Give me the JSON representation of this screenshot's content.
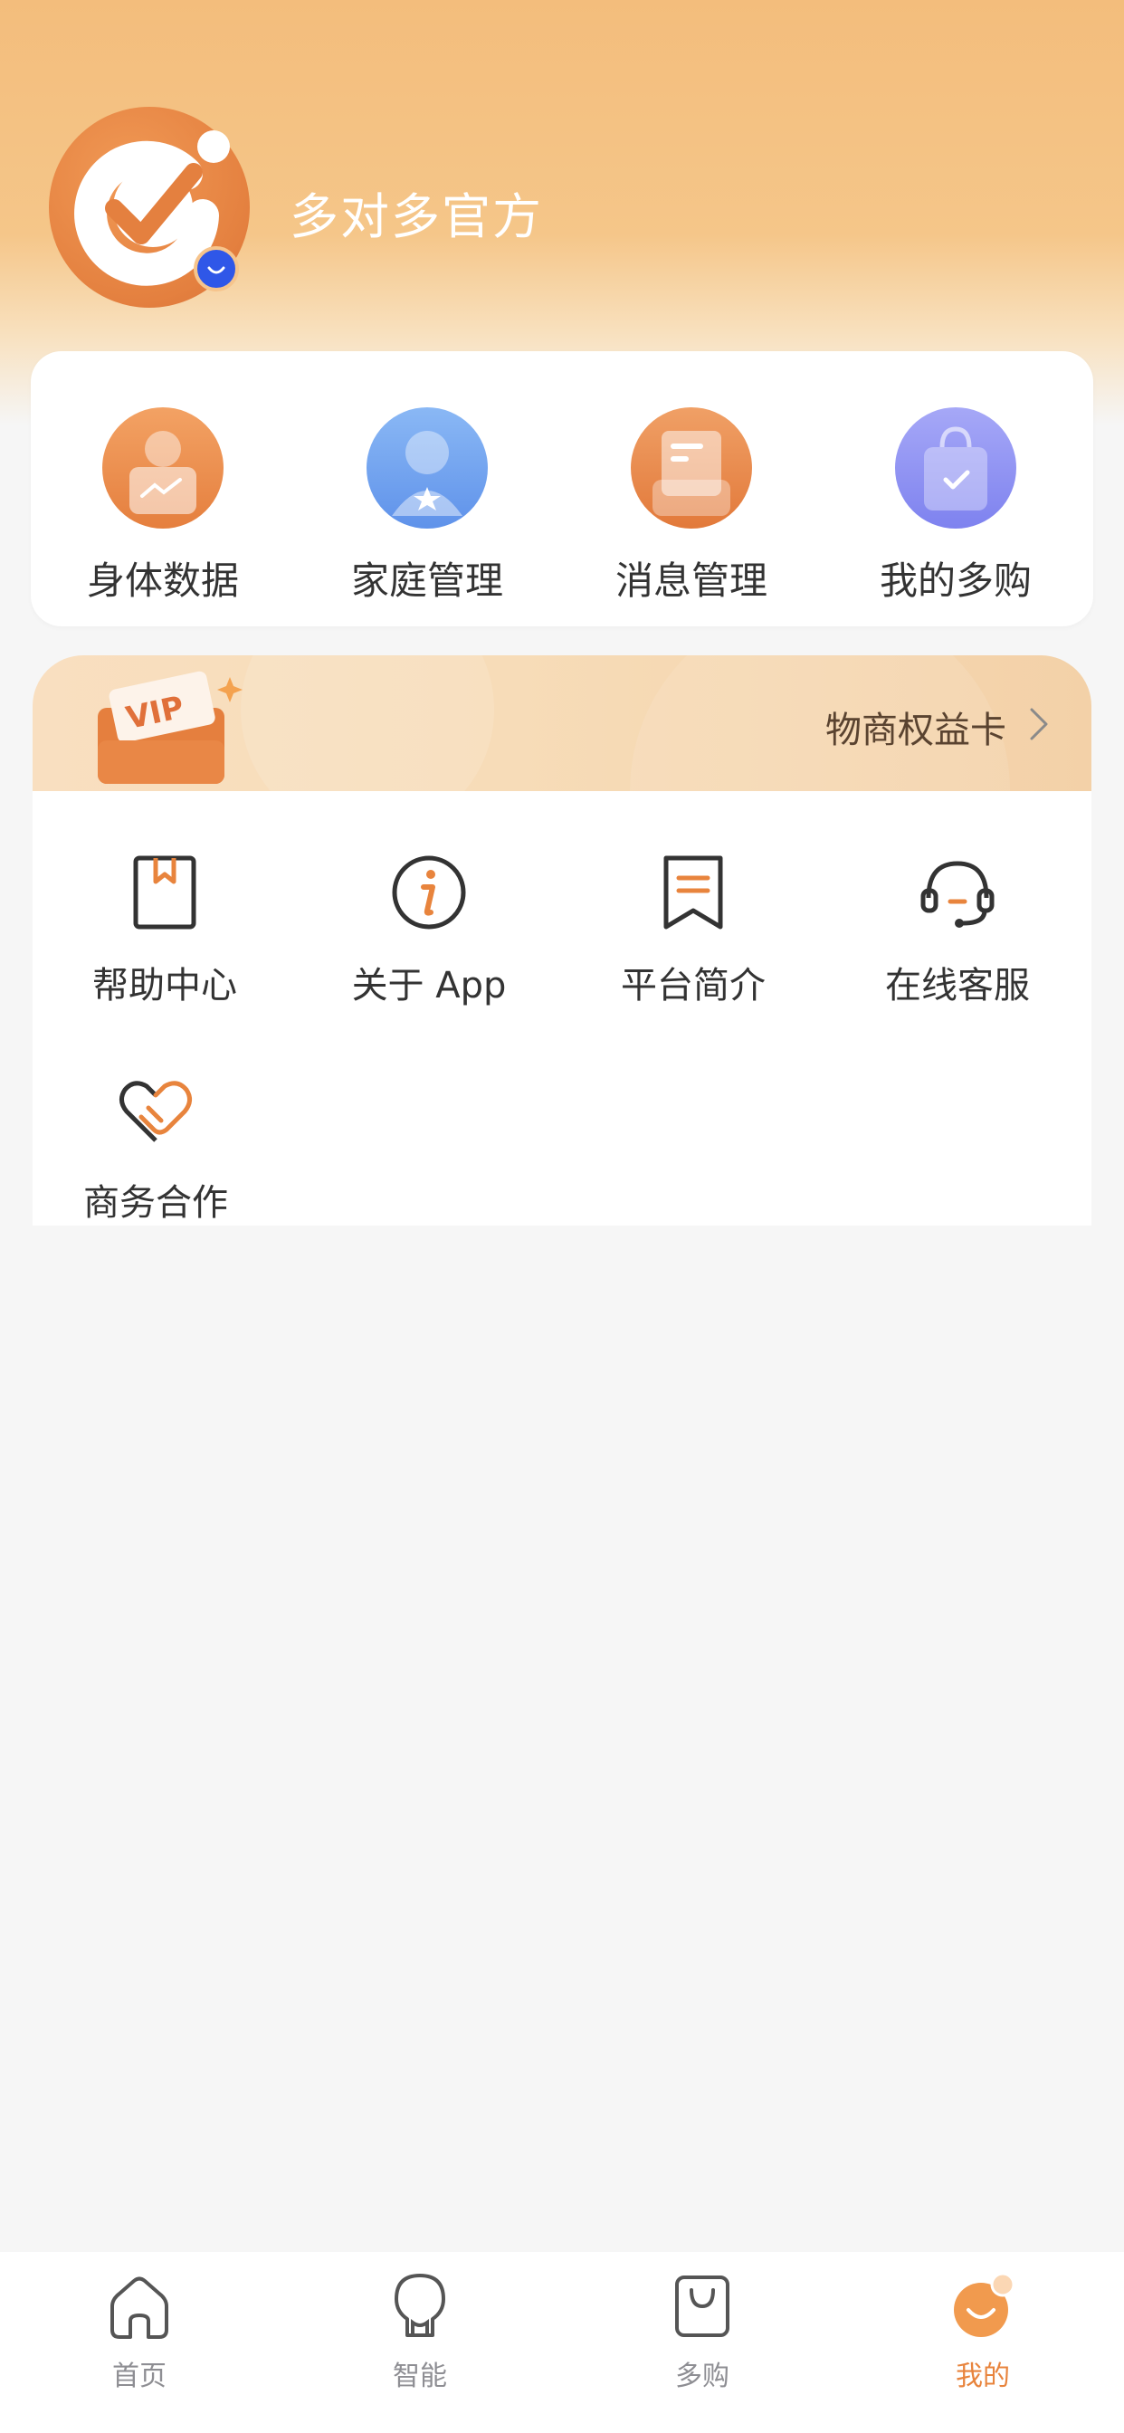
{
  "profile": {
    "username": "多对多官方"
  },
  "quick_actions": [
    {
      "label": "身体数据",
      "icon": "body-data-icon",
      "color": "#ec8d4b"
    },
    {
      "label": "家庭管理",
      "icon": "family-management-icon",
      "color": "#6fa2ee"
    },
    {
      "label": "消息管理",
      "icon": "message-management-icon",
      "color": "#ea8a4a"
    },
    {
      "label": "我的多购",
      "icon": "my-shopping-icon",
      "color": "#8c8ef2"
    }
  ],
  "vip_banner": {
    "badge": "VIP",
    "title": "物商权益卡"
  },
  "services": [
    {
      "label": "帮助中心",
      "icon": "bookmark-book-icon"
    },
    {
      "label": "关于 App",
      "icon": "info-icon"
    },
    {
      "label": "平台简介",
      "icon": "ribbon-doc-icon"
    },
    {
      "label": "在线客服",
      "icon": "headset-icon"
    },
    {
      "label": "商务合作",
      "icon": "handshake-heart-icon"
    }
  ],
  "tabbar": {
    "items": [
      {
        "label": "首页",
        "icon": "home-icon"
      },
      {
        "label": "智能",
        "icon": "bulb-icon"
      },
      {
        "label": "多购",
        "icon": "shopping-bag-icon"
      },
      {
        "label": "我的",
        "icon": "profile-smile-icon"
      }
    ],
    "active_color": "#e8843d",
    "inactive_color": "#8e8e93"
  },
  "colors": {
    "accent": "#e8843d",
    "header_gradient_top": "#f3bd7c",
    "page_bg": "#f6f6f6"
  }
}
